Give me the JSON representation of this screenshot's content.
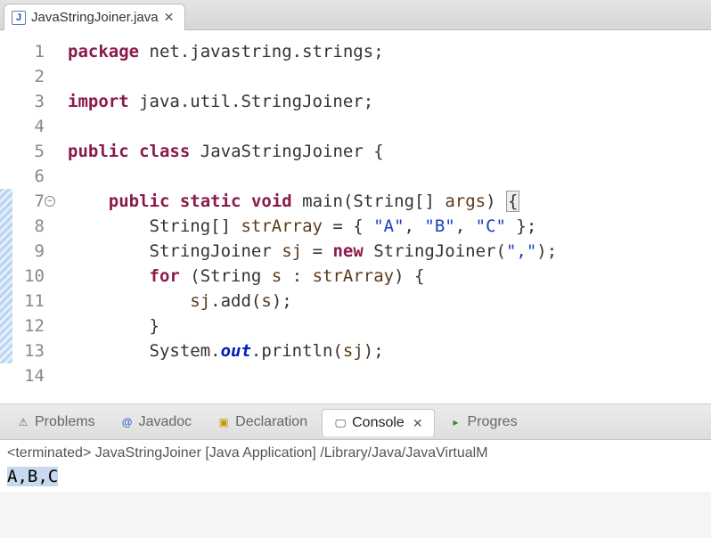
{
  "tab": {
    "filename": "JavaStringJoiner.java"
  },
  "code": {
    "lines": [
      {
        "n": 1
      },
      {
        "n": 2
      },
      {
        "n": 3
      },
      {
        "n": 4
      },
      {
        "n": 5
      },
      {
        "n": 6
      },
      {
        "n": 7
      },
      {
        "n": 8
      },
      {
        "n": 9
      },
      {
        "n": 10
      },
      {
        "n": 11
      },
      {
        "n": 12
      },
      {
        "n": 13
      },
      {
        "n": 14
      }
    ],
    "tokens": {
      "l1_kw1": "package",
      "l1_pkg": "net.javastring.strings;",
      "l3_kw1": "import",
      "l3_imp": "java.util.StringJoiner;",
      "l5_kw1": "public",
      "l5_kw2": "class",
      "l5_cls": "JavaStringJoiner",
      "l5_brace": "{",
      "l7_kw1": "public",
      "l7_kw2": "static",
      "l7_kw3": "void",
      "l7_m": "main",
      "l7_sig1": "(String[] ",
      "l7_arg": "args",
      "l7_sig2": ") ",
      "l7_brace": "{",
      "l8_t1": "String[] ",
      "l8_v": "strArray",
      "l8_t2": " = { ",
      "l8_sA": "\"A\"",
      "l8_c1": ", ",
      "l8_sB": "\"B\"",
      "l8_c2": ", ",
      "l8_sC": "\"C\"",
      "l8_t3": " };",
      "l9_t1": "StringJoiner ",
      "l9_v": "sj",
      "l9_t2": " = ",
      "l9_kw": "new",
      "l9_t3": " StringJoiner(",
      "l9_s": "\",\"",
      "l9_t4": ");",
      "l10_kw": "for",
      "l10_t1": " (String ",
      "l10_v1": "s",
      "l10_t2": " : ",
      "l10_v2": "strArray",
      "l10_t3": ") {",
      "l11_v1": "sj",
      "l11_t1": ".add(",
      "l11_v2": "s",
      "l11_t2": ");",
      "l12_t": "}",
      "l13_t1": "System.",
      "l13_out": "out",
      "l13_t2": ".println(",
      "l13_v": "sj",
      "l13_t3": ");"
    }
  },
  "panel": {
    "tabs": {
      "problems": "Problems",
      "javadoc": "Javadoc",
      "declaration": "Declaration",
      "console": "Console",
      "progress": "Progres"
    }
  },
  "console": {
    "header": "<terminated> JavaStringJoiner [Java Application] /Library/Java/JavaVirtualM",
    "output": "A,B,C"
  }
}
